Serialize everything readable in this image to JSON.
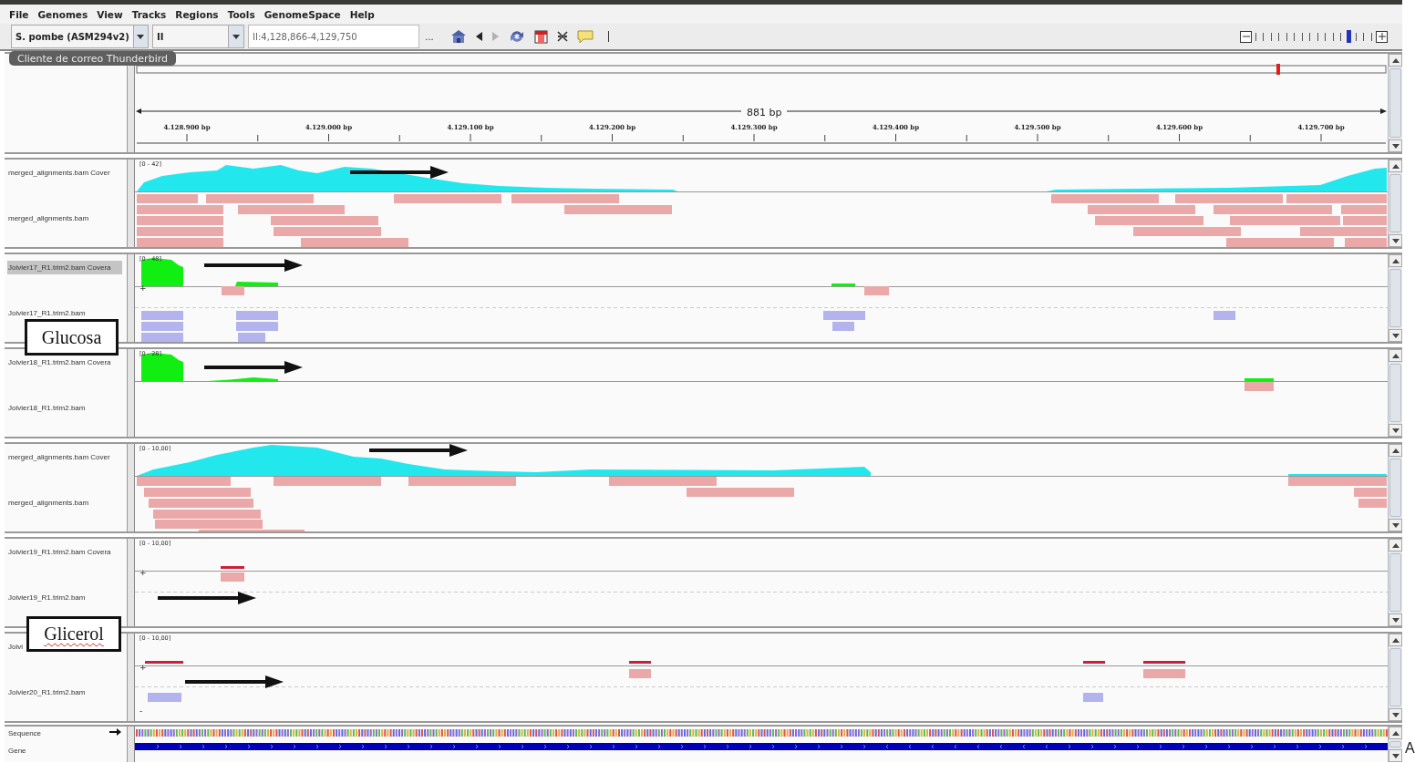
{
  "menu": [
    {
      "label": "File"
    },
    {
      "label": "Genomes"
    },
    {
      "label": "View"
    },
    {
      "label": "Tracks"
    },
    {
      "label": "Regions"
    },
    {
      "label": "Tools"
    },
    {
      "label": "GenomeSpace"
    },
    {
      "label": "Help"
    }
  ],
  "toolbar": {
    "genome": "S. pombe (ASM294v2)",
    "chromosome": "II",
    "locus": "II:4,128,866-4,129,750",
    "more": "...",
    "forward_disabled": true,
    "zoom": {
      "level": 0.81
    }
  },
  "tooltip": "Cliente de correo Thunderbird",
  "ruler": {
    "span": "881 bp",
    "ticks": [
      "4.128.900 bp",
      "4.129.000 bp",
      "4.129.100 bp",
      "4.129.200 bp",
      "4.129.300 bp",
      "4.129.400 bp",
      "4.129.500 bp",
      "4.129.600 bp",
      "4.129.700 bp"
    ]
  },
  "tracks": [
    {
      "coverage_label": "merged_alignments.bam Cover",
      "reads_label": "merged_alignments.bam",
      "range": "[0 - 42]",
      "selected": false
    },
    {
      "coverage_label": "Joivier17_R1.trim2.bam Covera",
      "reads_label": "Joivier17_R1.trim2.bam",
      "range": "[0 - 48]",
      "selected": true,
      "strand_labels": [
        "+"
      ]
    },
    {
      "coverage_label": "Joivier18_R1.trim2.bam Covera",
      "reads_label": "Joivier18_R1.trim2.bam",
      "range": "[0 - 28]",
      "selected": false
    },
    {
      "coverage_label": "merged_alignments.bam Cover",
      "reads_label": "merged_alignments.bam",
      "range": "[0 - 10,00]",
      "selected": false
    },
    {
      "coverage_label": "Joivier19_R1.trim2.bam Covera",
      "reads_label": "Joivier19_R1.trim2.bam",
      "range": "[0 - 10,00]",
      "selected": false,
      "strand_labels": [
        "+"
      ]
    },
    {
      "coverage_label": "Joivi",
      "reads_label": "Joivier20_R1.trim2.bam",
      "range": "[0 - 10,00]",
      "selected": false,
      "strand_labels": [
        "+",
        "-"
      ]
    }
  ],
  "annotations": [
    {
      "text": "Glucosa",
      "spell_error": false
    },
    {
      "text": "Glicerol",
      "spell_error": true
    }
  ],
  "bottom": {
    "tracks": [
      {
        "label": "Sequence"
      },
      {
        "label": "Gene"
      }
    ]
  },
  "edge_text": "A"
}
